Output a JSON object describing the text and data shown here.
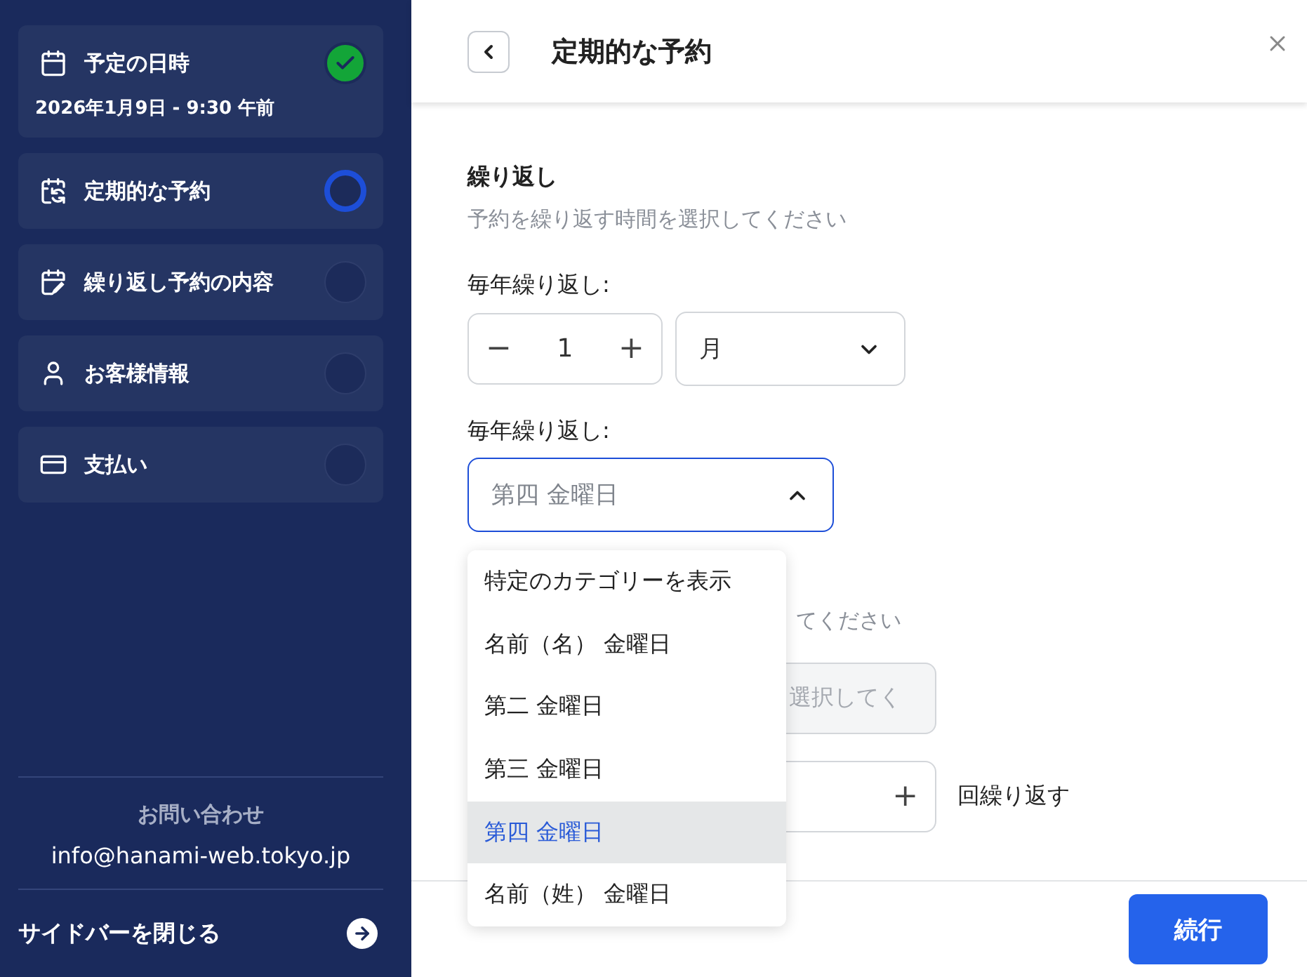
{
  "sidebar": {
    "steps": [
      {
        "label": "予定の日時",
        "subtitle": "2026年1月9日 - 9:30 午前",
        "completed": true,
        "selected": false
      },
      {
        "label": "定期的な予約",
        "completed": false,
        "selected": true
      },
      {
        "label": "繰り返し予約の内容",
        "completed": false,
        "selected": false
      },
      {
        "label": "お客様情報",
        "completed": false,
        "selected": false
      },
      {
        "label": "支払い",
        "completed": false,
        "selected": false
      }
    ],
    "contact_label": "お問い合わせ",
    "contact_email": "info@hanami-web.tokyo.jp",
    "close_sidebar": "サイドバーを閉じる"
  },
  "header": {
    "title": "定期的な予約"
  },
  "section": {
    "title": "繰り返し",
    "hint": "予約を繰り返す時間を選択してください"
  },
  "interval": {
    "label": "毎年繰り返し:",
    "minus": "−",
    "value": "1",
    "plus": "+",
    "unit": "月"
  },
  "pattern": {
    "label": "毎年繰り返し:",
    "value": "第四 金曜日",
    "expanded": true,
    "options": [
      {
        "label": "特定のカテゴリーを表示",
        "selected": false
      },
      {
        "label": "名前（名） 金曜日",
        "selected": false
      },
      {
        "label": "第二 金曜日",
        "selected": false
      },
      {
        "label": "第三 金曜日",
        "selected": false
      },
      {
        "label": "第四 金曜日",
        "selected": true
      },
      {
        "label": "名前（姓） 金曜日",
        "selected": false
      }
    ]
  },
  "covered": {
    "hint": "てください",
    "field_placeholder": "選択してく",
    "plus": "+",
    "suffix": "回繰り返す"
  },
  "footer": {
    "continue": "続行"
  }
}
